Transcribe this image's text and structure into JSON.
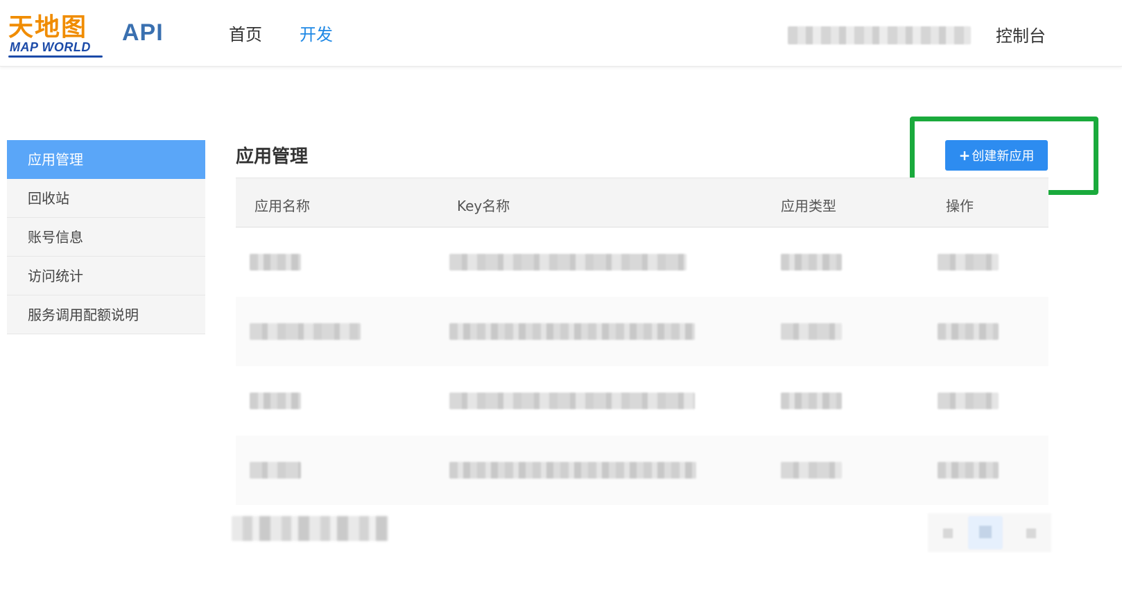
{
  "header": {
    "logo_cn": "天地图",
    "logo_en": "MAP WORLD",
    "api_label": "API",
    "nav": [
      {
        "label": "首页",
        "active": false
      },
      {
        "label": "开发",
        "active": true
      }
    ],
    "console_label": "控制台"
  },
  "sidebar": {
    "items": [
      {
        "label": "应用管理",
        "active": true
      },
      {
        "label": "回收站",
        "active": false
      },
      {
        "label": "账号信息",
        "active": false
      },
      {
        "label": "访问统计",
        "active": false
      },
      {
        "label": "服务调用配额说明",
        "active": false
      }
    ]
  },
  "main": {
    "title": "应用管理",
    "create_button": {
      "icon": "plus-icon",
      "label": "创建新应用"
    },
    "table": {
      "columns": [
        "应用名称",
        "Key名称",
        "应用类型",
        "操作"
      ]
    }
  },
  "colors": {
    "accent": "#2d8cf0",
    "sidebar_active": "#5aa6f8",
    "highlight": "#1aaa3c",
    "nav_active": "#1e88e5"
  }
}
